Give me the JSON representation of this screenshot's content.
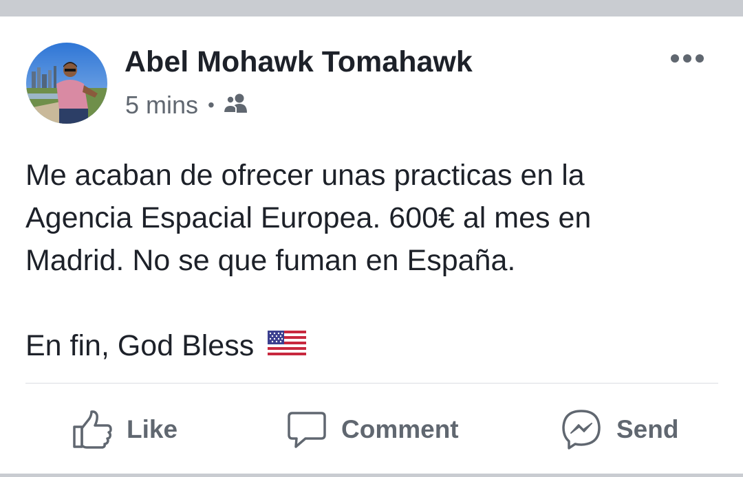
{
  "post": {
    "author_name": "Abel Mohawk Tomahawk",
    "timestamp": "5 mins",
    "separator": "•",
    "audience_icon": "friends-icon",
    "text_lines": [
      "Me acaban de ofrecer unas practicas en la",
      "Agencia Espacial Europea. 600€ al mes en",
      "Madrid. No se que fuman en España."
    ],
    "closing_line": "En fin, God Bless",
    "closing_emoji": "us-flag-emoji"
  },
  "actions": {
    "like_label": "Like",
    "comment_label": "Comment",
    "send_label": "Send"
  },
  "colors": {
    "primary_text": "#1d2129",
    "secondary_text": "#606770",
    "band": "#c9ccd1",
    "divider": "#dadde1"
  }
}
